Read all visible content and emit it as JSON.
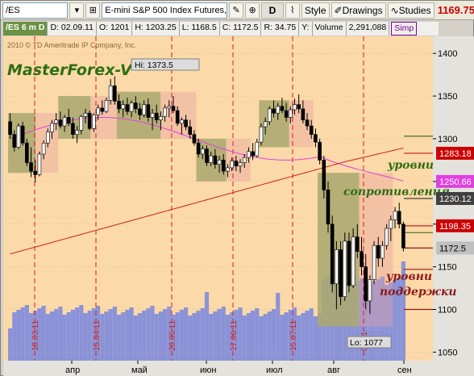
{
  "toolbar": {
    "symbol": "/ES",
    "instrument": "E-mini S&P 500 Index Futures,...",
    "d_button": "D",
    "style_label": "Style",
    "drawings_label": "Drawings",
    "studies_label": "Studies",
    "last_price": "1169.75",
    "icons": [
      "search-icon",
      "dropdown-icon",
      "link-icon",
      "flag-icon",
      "wrench-icon",
      "zoom-icon",
      "chart-type-icon",
      "style-icon",
      "pencil-icon",
      "studies-icon"
    ]
  },
  "infobar": {
    "symbol": "/ES 6 m D",
    "date": "D: 02.09.11",
    "open": "O: 1201",
    "high": "H: 1203.25",
    "low": "L: 1168.5",
    "close": "C: 1172.5",
    "range": "R: 34.75",
    "y": "Y:",
    "volume_label": "Volume",
    "volume": "2,291,088",
    "simp": "Simp"
  },
  "copyright": "2010 © TD Ameritrade IP Company, Inc.",
  "watermark": "MasterForex-V",
  "hi_label": "Hi: 1373.5",
  "lo_label": "Lo: 1077",
  "annotations": {
    "resistance_1": "уровни",
    "resistance_2": "сопротивления",
    "support_1": "уровни",
    "support_2": "поддержки"
  },
  "colors": {
    "background": "#fcd9a8",
    "bullish_volume": "#79b04a",
    "price_line": "#cc0000",
    "ma_pink": "#e040e0",
    "ma_red": "#cc2020",
    "volume_bars": "#8b93d8"
  },
  "chart_data": {
    "type": "candlestick",
    "y_ticks": [
      1050,
      1100,
      1150,
      1200,
      1250,
      1300,
      1350,
      1400
    ],
    "ylim": [
      1040,
      1420
    ],
    "x_months": [
      "апр",
      "май",
      "июн",
      "июл",
      "авг",
      "сен"
    ],
    "date_markers": [
      "18.03.11",
      "15.04.11",
      "20.05.11",
      "17.06.11",
      "15.07.11",
      "08.11"
    ],
    "price_tags": [
      {
        "value": "1283.18",
        "color": "#cc0000"
      },
      {
        "value": "1250.66",
        "color": "#e040e0"
      },
      {
        "value": "1230.12",
        "color": "#404040"
      },
      {
        "value": "1198.35",
        "color": "#cc0000"
      },
      {
        "value": "1172.5",
        "color": "#c0c0c0"
      }
    ],
    "ohlc": [
      {
        "o": 1320,
        "h": 1330,
        "l": 1300,
        "c": 1305
      },
      {
        "o": 1305,
        "h": 1310,
        "l": 1285,
        "c": 1290
      },
      {
        "o": 1290,
        "h": 1318,
        "l": 1288,
        "c": 1315
      },
      {
        "o": 1315,
        "h": 1320,
        "l": 1292,
        "c": 1295
      },
      {
        "o": 1295,
        "h": 1300,
        "l": 1268,
        "c": 1272
      },
      {
        "o": 1272,
        "h": 1290,
        "l": 1255,
        "c": 1262
      },
      {
        "o": 1262,
        "h": 1275,
        "l": 1249,
        "c": 1258
      },
      {
        "o": 1258,
        "h": 1285,
        "l": 1256,
        "c": 1282
      },
      {
        "o": 1282,
        "h": 1298,
        "l": 1276,
        "c": 1295
      },
      {
        "o": 1295,
        "h": 1312,
        "l": 1290,
        "c": 1308
      },
      {
        "o": 1308,
        "h": 1322,
        "l": 1300,
        "c": 1318
      },
      {
        "o": 1318,
        "h": 1330,
        "l": 1310,
        "c": 1322
      },
      {
        "o": 1322,
        "h": 1332,
        "l": 1312,
        "c": 1315
      },
      {
        "o": 1315,
        "h": 1328,
        "l": 1308,
        "c": 1325
      },
      {
        "o": 1325,
        "h": 1335,
        "l": 1315,
        "c": 1318
      },
      {
        "o": 1318,
        "h": 1325,
        "l": 1300,
        "c": 1305
      },
      {
        "o": 1305,
        "h": 1315,
        "l": 1295,
        "c": 1310
      },
      {
        "o": 1310,
        "h": 1328,
        "l": 1305,
        "c": 1326
      },
      {
        "o": 1326,
        "h": 1335,
        "l": 1318,
        "c": 1330
      },
      {
        "o": 1330,
        "h": 1333,
        "l": 1310,
        "c": 1312
      },
      {
        "o": 1312,
        "h": 1330,
        "l": 1308,
        "c": 1328
      },
      {
        "o": 1328,
        "h": 1340,
        "l": 1322,
        "c": 1336
      },
      {
        "o": 1336,
        "h": 1345,
        "l": 1328,
        "c": 1332
      },
      {
        "o": 1332,
        "h": 1348,
        "l": 1330,
        "c": 1345
      },
      {
        "o": 1345,
        "h": 1370,
        "l": 1340,
        "c": 1362
      },
      {
        "o": 1362,
        "h": 1373,
        "l": 1340,
        "c": 1344
      },
      {
        "o": 1344,
        "h": 1352,
        "l": 1330,
        "c": 1335
      },
      {
        "o": 1335,
        "h": 1345,
        "l": 1325,
        "c": 1340
      },
      {
        "o": 1340,
        "h": 1348,
        "l": 1328,
        "c": 1332
      },
      {
        "o": 1332,
        "h": 1345,
        "l": 1325,
        "c": 1342
      },
      {
        "o": 1342,
        "h": 1350,
        "l": 1330,
        "c": 1335
      },
      {
        "o": 1335,
        "h": 1342,
        "l": 1322,
        "c": 1328
      },
      {
        "o": 1328,
        "h": 1345,
        "l": 1325,
        "c": 1340
      },
      {
        "o": 1340,
        "h": 1347,
        "l": 1320,
        "c": 1325
      },
      {
        "o": 1325,
        "h": 1335,
        "l": 1310,
        "c": 1330
      },
      {
        "o": 1330,
        "h": 1340,
        "l": 1318,
        "c": 1322
      },
      {
        "o": 1322,
        "h": 1332,
        "l": 1310,
        "c": 1326
      },
      {
        "o": 1326,
        "h": 1340,
        "l": 1320,
        "c": 1336
      },
      {
        "o": 1336,
        "h": 1345,
        "l": 1325,
        "c": 1338
      },
      {
        "o": 1338,
        "h": 1350,
        "l": 1330,
        "c": 1333
      },
      {
        "o": 1333,
        "h": 1338,
        "l": 1315,
        "c": 1318
      },
      {
        "o": 1318,
        "h": 1325,
        "l": 1305,
        "c": 1322
      },
      {
        "o": 1322,
        "h": 1328,
        "l": 1310,
        "c": 1314
      },
      {
        "o": 1314,
        "h": 1322,
        "l": 1300,
        "c": 1305
      },
      {
        "o": 1305,
        "h": 1310,
        "l": 1292,
        "c": 1295
      },
      {
        "o": 1295,
        "h": 1300,
        "l": 1278,
        "c": 1282
      },
      {
        "o": 1282,
        "h": 1292,
        "l": 1276,
        "c": 1288
      },
      {
        "o": 1288,
        "h": 1292,
        "l": 1268,
        "c": 1272
      },
      {
        "o": 1272,
        "h": 1285,
        "l": 1268,
        "c": 1280
      },
      {
        "o": 1280,
        "h": 1288,
        "l": 1265,
        "c": 1270
      },
      {
        "o": 1270,
        "h": 1280,
        "l": 1260,
        "c": 1275
      },
      {
        "o": 1275,
        "h": 1282,
        "l": 1258,
        "c": 1262
      },
      {
        "o": 1262,
        "h": 1270,
        "l": 1255,
        "c": 1266
      },
      {
        "o": 1266,
        "h": 1278,
        "l": 1262,
        "c": 1274
      },
      {
        "o": 1274,
        "h": 1280,
        "l": 1262,
        "c": 1268
      },
      {
        "o": 1268,
        "h": 1276,
        "l": 1260,
        "c": 1272
      },
      {
        "o": 1272,
        "h": 1282,
        "l": 1266,
        "c": 1278
      },
      {
        "o": 1278,
        "h": 1290,
        "l": 1272,
        "c": 1285
      },
      {
        "o": 1285,
        "h": 1295,
        "l": 1275,
        "c": 1280
      },
      {
        "o": 1280,
        "h": 1300,
        "l": 1278,
        "c": 1296
      },
      {
        "o": 1296,
        "h": 1318,
        "l": 1292,
        "c": 1314
      },
      {
        "o": 1314,
        "h": 1325,
        "l": 1305,
        "c": 1320
      },
      {
        "o": 1320,
        "h": 1338,
        "l": 1316,
        "c": 1335
      },
      {
        "o": 1335,
        "h": 1345,
        "l": 1325,
        "c": 1330
      },
      {
        "o": 1330,
        "h": 1342,
        "l": 1322,
        "c": 1338
      },
      {
        "o": 1338,
        "h": 1348,
        "l": 1330,
        "c": 1333
      },
      {
        "o": 1333,
        "h": 1342,
        "l": 1320,
        "c": 1325
      },
      {
        "o": 1325,
        "h": 1338,
        "l": 1318,
        "c": 1334
      },
      {
        "o": 1334,
        "h": 1347,
        "l": 1328,
        "c": 1340
      },
      {
        "o": 1340,
        "h": 1352,
        "l": 1330,
        "c": 1335
      },
      {
        "o": 1335,
        "h": 1345,
        "l": 1318,
        "c": 1322
      },
      {
        "o": 1322,
        "h": 1330,
        "l": 1310,
        "c": 1315
      },
      {
        "o": 1315,
        "h": 1322,
        "l": 1300,
        "c": 1305
      },
      {
        "o": 1305,
        "h": 1312,
        "l": 1290,
        "c": 1296
      },
      {
        "o": 1296,
        "h": 1300,
        "l": 1270,
        "c": 1275
      },
      {
        "o": 1275,
        "h": 1280,
        "l": 1230,
        "c": 1240
      },
      {
        "o": 1240,
        "h": 1250,
        "l": 1190,
        "c": 1200
      },
      {
        "o": 1200,
        "h": 1210,
        "l": 1120,
        "c": 1130
      },
      {
        "o": 1130,
        "h": 1180,
        "l": 1100,
        "c": 1170
      },
      {
        "o": 1170,
        "h": 1180,
        "l": 1105,
        "c": 1115
      },
      {
        "o": 1115,
        "h": 1190,
        "l": 1110,
        "c": 1180
      },
      {
        "o": 1180,
        "h": 1190,
        "l": 1120,
        "c": 1128
      },
      {
        "o": 1128,
        "h": 1195,
        "l": 1125,
        "c": 1185
      },
      {
        "o": 1185,
        "h": 1200,
        "l": 1160,
        "c": 1168
      },
      {
        "o": 1168,
        "h": 1185,
        "l": 1140,
        "c": 1150
      },
      {
        "o": 1150,
        "h": 1165,
        "l": 1100,
        "c": 1110
      },
      {
        "o": 1110,
        "h": 1140,
        "l": 1095,
        "c": 1135
      },
      {
        "o": 1135,
        "h": 1180,
        "l": 1130,
        "c": 1175
      },
      {
        "o": 1175,
        "h": 1185,
        "l": 1150,
        "c": 1160
      },
      {
        "o": 1160,
        "h": 1180,
        "l": 1150,
        "c": 1175
      },
      {
        "o": 1175,
        "h": 1200,
        "l": 1170,
        "c": 1195
      },
      {
        "o": 1195,
        "h": 1210,
        "l": 1180,
        "c": 1205
      },
      {
        "o": 1205,
        "h": 1220,
        "l": 1195,
        "c": 1215
      },
      {
        "o": 1215,
        "h": 1225,
        "l": 1195,
        "c": 1200
      },
      {
        "o": 1200,
        "h": 1203,
        "l": 1168,
        "c": 1172
      }
    ]
  }
}
